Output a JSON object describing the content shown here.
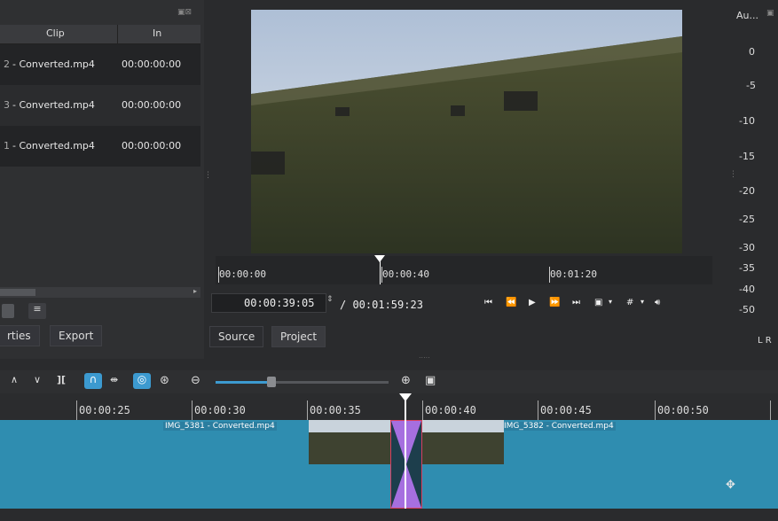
{
  "playlist": {
    "columns": [
      "Clip",
      "In"
    ],
    "rows": [
      {
        "clip": "- Converted.mp4",
        "in": "00:00:00:00"
      },
      {
        "clip": "- Converted.mp4",
        "in": "00:00:00:00"
      },
      {
        "clip": "- Converted.mp4",
        "in": "00:00:00:00"
      }
    ],
    "tabs": [
      "rties",
      "Export"
    ]
  },
  "player": {
    "ruler_labels": [
      "00:00:00",
      "00:00:40",
      "00:01:20"
    ],
    "position": "00:00:39:05",
    "duration": "/ 00:01:59:23",
    "tabs": [
      "Source",
      "Project"
    ]
  },
  "meter": {
    "title": "Au...",
    "scale": [
      "0",
      "-5",
      "-10",
      "-15",
      "-20",
      "-25",
      "-30",
      "-35",
      "-40",
      "-50"
    ],
    "channels": "L R"
  },
  "timeline": {
    "ruler_labels": [
      "00:00:25",
      "00:00:30",
      "00:00:35",
      "00:00:40",
      "00:00:45",
      "00:00:50"
    ],
    "clip1": "IMG_5381 - Converted.mp4",
    "clip2": "IMG_5382 - Converted.mp4",
    "zoom_level": 0.3
  },
  "colors": {
    "track": "#2f8db0",
    "transition": "#a66fe0",
    "playhead": "#ffffff"
  }
}
